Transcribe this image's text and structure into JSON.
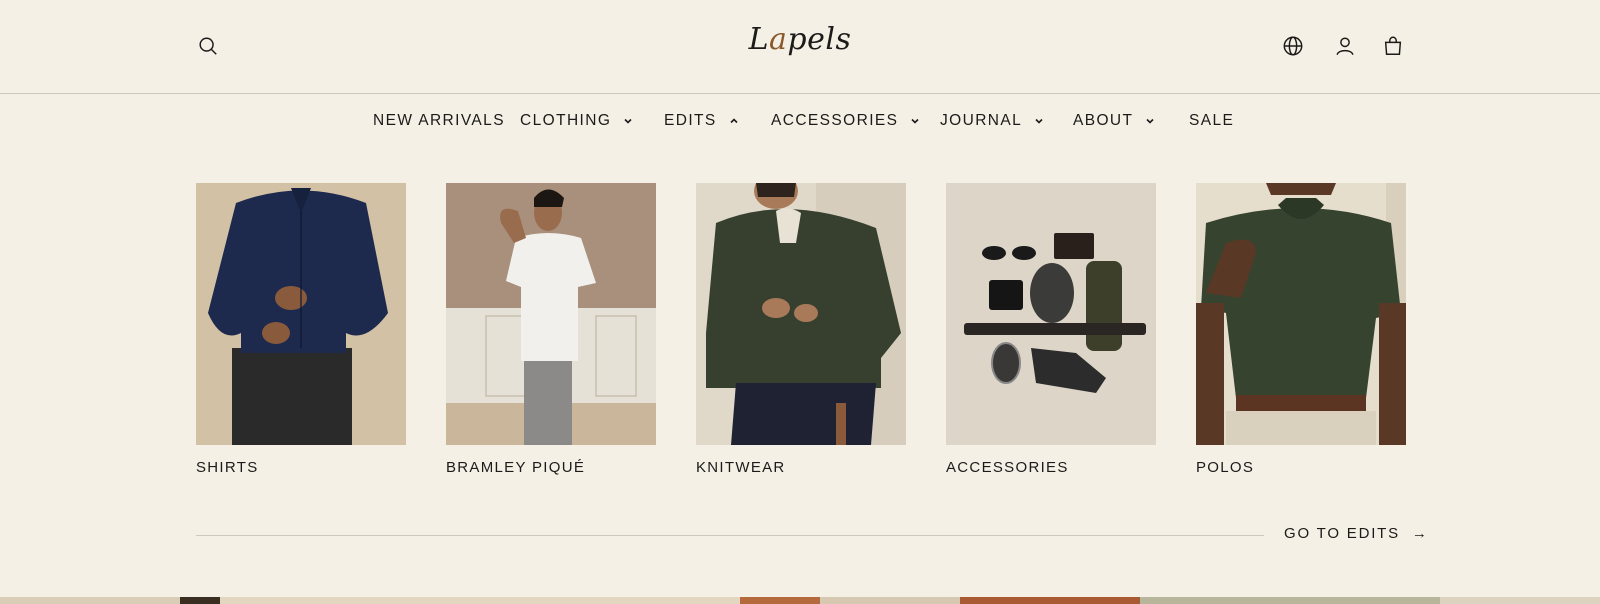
{
  "brand": {
    "logo_part1": "L",
    "logo_accent": "a",
    "logo_part2": "pels",
    "accent_color": "#8a5a2b"
  },
  "header": {
    "icons": [
      "search-icon",
      "globe-icon",
      "user-icon",
      "bag-icon"
    ]
  },
  "nav": {
    "items": [
      {
        "label": "NEW ARRIVALS",
        "has_chevron": false
      },
      {
        "label": "CLOTHING",
        "has_chevron": true,
        "chevron": "down"
      },
      {
        "label": "EDITS",
        "has_chevron": true,
        "chevron": "up"
      },
      {
        "label": "ACCESSORIES",
        "has_chevron": true,
        "chevron": "down"
      },
      {
        "label": "JOURNAL",
        "has_chevron": true,
        "chevron": "down"
      },
      {
        "label": "ABOUT",
        "has_chevron": true,
        "chevron": "down"
      },
      {
        "label": "SALE",
        "has_chevron": false
      }
    ]
  },
  "edits": {
    "cards": [
      {
        "label": "SHIRTS"
      },
      {
        "label": "BRAMLEY PIQUÉ"
      },
      {
        "label": "KNITWEAR"
      },
      {
        "label": "ACCESSORIES"
      },
      {
        "label": "POLOS"
      }
    ],
    "go_label": "GO TO EDITS",
    "go_arrow": "→"
  },
  "colors": {
    "background": "#f5f0e6",
    "text": "#1c1b19",
    "divider": "#cfc9bd"
  }
}
